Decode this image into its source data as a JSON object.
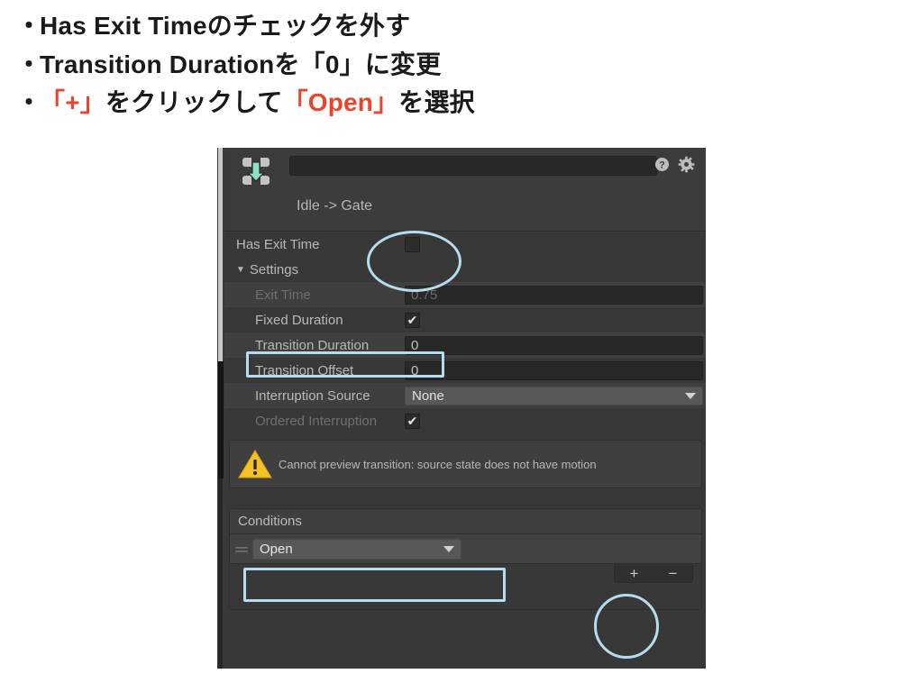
{
  "instructions": {
    "bullet_char": "・",
    "lines": [
      {
        "segments": [
          {
            "text": "Has Exit Timeのチェックを外す",
            "color": "black"
          }
        ]
      },
      {
        "segments": [
          {
            "text": "Transition Durationを「0」に変更",
            "color": "black"
          }
        ]
      },
      {
        "segments": [
          {
            "text": "「+」",
            "color": "red"
          },
          {
            "text": "をクリックして",
            "color": "black"
          },
          {
            "text": "「Open」",
            "color": "red"
          },
          {
            "text": "を選択",
            "color": "black"
          }
        ]
      }
    ],
    "accent_color": "#e8452c",
    "text_color": "#1a1a1a"
  },
  "inspector": {
    "icon_name": "animator-transition-icon",
    "name_field_value": "",
    "help_icon": "help-circle-icon",
    "gear_icon": "gear-icon",
    "transition_title": "Idle -> Gate",
    "rows": [
      {
        "label": "Has Exit Time",
        "control": "checkbox",
        "checked": false,
        "dim": false,
        "indent": false,
        "shaded": false
      },
      {
        "label": "Settings",
        "control": "foldout",
        "foldout_arrow": "▼",
        "expanded": true,
        "dim": false,
        "indent": false,
        "shaded": false
      },
      {
        "label": "Exit Time",
        "control": "text",
        "value": "0.75",
        "dim": true,
        "indent": true,
        "shaded": true
      },
      {
        "label": "Fixed Duration",
        "control": "checkbox",
        "checked": true,
        "dim": false,
        "indent": true,
        "shaded": false
      },
      {
        "label": "Transition Duration",
        "control": "text",
        "value": "0",
        "dim": false,
        "indent": true,
        "shaded": true
      },
      {
        "label": "Transition Offset",
        "control": "text",
        "value": "0",
        "dim": false,
        "indent": true,
        "shaded": false
      },
      {
        "label": "Interruption Source",
        "control": "dropdown",
        "value": "None",
        "dim": false,
        "indent": true,
        "shaded": true
      },
      {
        "label": "Ordered Interruption",
        "control": "checkbox",
        "checked": true,
        "dim": true,
        "indent": true,
        "shaded": false
      }
    ],
    "warning": {
      "icon_name": "warning-triangle-icon",
      "text": "Cannot preview transition: source state does not have motion"
    },
    "conditions": {
      "header": "Conditions",
      "rows": [
        {
          "parameter": "Open"
        }
      ],
      "add_label": "+",
      "remove_label": "−"
    }
  },
  "annotations": {
    "color": "#b6dcf0",
    "items": [
      {
        "name": "has-exit-time-checkbox-annotation",
        "shape": "ellipse"
      },
      {
        "name": "transition-duration-annotation",
        "shape": "rect"
      },
      {
        "name": "condition-open-annotation",
        "shape": "rect"
      },
      {
        "name": "add-condition-annotation",
        "shape": "circle"
      }
    ]
  }
}
